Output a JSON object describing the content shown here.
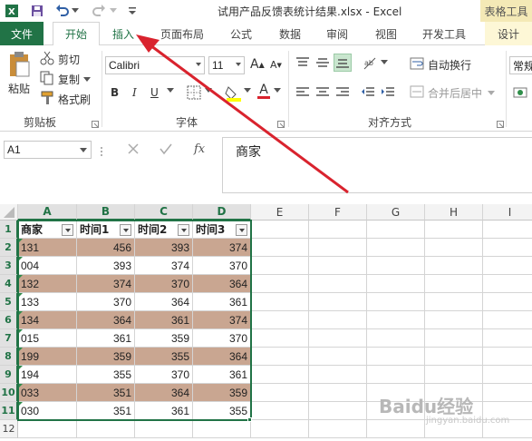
{
  "quick_access": {
    "save_icon": "save-icon",
    "undo_icon": "undo-icon",
    "redo_icon": "redo-icon",
    "customize_icon": "customize-qat-icon"
  },
  "window_title": "试用产品反馈表统计结果.xlsx - Excel",
  "context_tab_label": "表格工具",
  "tabs": {
    "file": "文件",
    "home": "开始",
    "insert": "插入",
    "page_layout": "页面布局",
    "formulas": "公式",
    "data": "数据",
    "review": "审阅",
    "view": "视图",
    "developer": "开发工具",
    "design": "设计"
  },
  "ribbon": {
    "clipboard": {
      "paste": "粘贴",
      "cut": "剪切",
      "copy": "复制",
      "format_painter": "格式刷",
      "label": "剪贴板"
    },
    "font": {
      "name": "Calibri",
      "size": "11",
      "label": "字体",
      "grow": "A",
      "shrink": "A",
      "bold": "B",
      "italic": "I",
      "underline": "U",
      "wen": "wén",
      "font_color": "A"
    },
    "alignment": {
      "wrap_text": "自动换行",
      "merge_center": "合并后居中",
      "label": "对齐方式"
    },
    "number": {
      "format": "常规"
    }
  },
  "formula_bar": {
    "name_box": "A1",
    "content": "商家",
    "fx": "fx"
  },
  "grid": {
    "columns": [
      "A",
      "B",
      "C",
      "D",
      "E",
      "F",
      "G",
      "H",
      "I"
    ],
    "rows": [
      "1",
      "2",
      "3",
      "4",
      "5",
      "6",
      "7",
      "8",
      "9",
      "10",
      "11",
      "12"
    ],
    "headers": [
      "商家",
      "时间1",
      "时间2",
      "时间3"
    ],
    "data": [
      [
        "131",
        "456",
        "393",
        "374"
      ],
      [
        "004",
        "393",
        "374",
        "370"
      ],
      [
        "132",
        "374",
        "370",
        "364"
      ],
      [
        "133",
        "370",
        "364",
        "361"
      ],
      [
        "134",
        "364",
        "361",
        "374"
      ],
      [
        "015",
        "361",
        "359",
        "370"
      ],
      [
        "199",
        "359",
        "355",
        "364"
      ],
      [
        "194",
        "355",
        "370",
        "361"
      ],
      [
        "033",
        "351",
        "364",
        "359"
      ],
      [
        "030",
        "351",
        "361",
        "355"
      ]
    ]
  },
  "watermark": "Baidu经验",
  "watermark_sub": "jingyan.baidu.com",
  "colors": {
    "accent": "#217346",
    "band": "#c9a691",
    "arrow": "#d9232e"
  }
}
